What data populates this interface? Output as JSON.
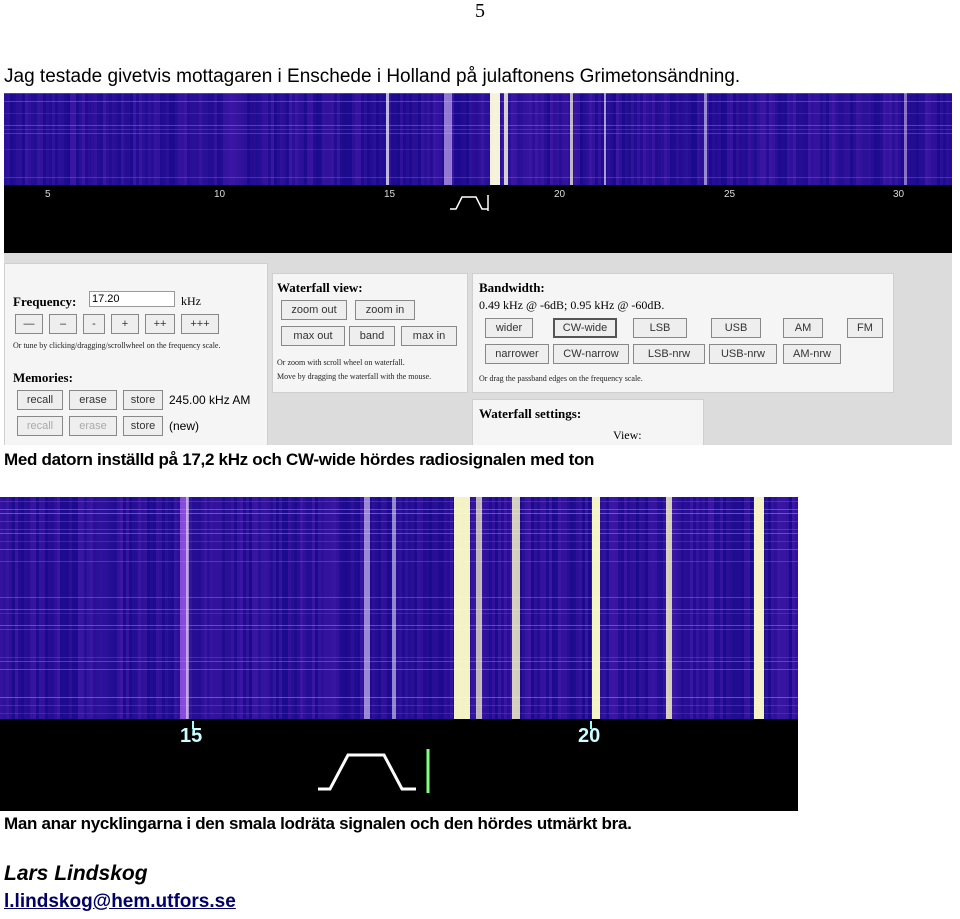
{
  "page_number": "5",
  "intro": "Jag testade givetvis mottagaren i Enschede i Holland på julaftonens Grimetonsändning.",
  "screenshot1": {
    "scale_ticks": [
      "5",
      "10",
      "15",
      "20",
      "25",
      "30"
    ],
    "frequency": {
      "label": "Frequency:",
      "value": "17.20",
      "unit": "kHz",
      "buttons": [
        "—",
        "–",
        "-",
        "+",
        "++",
        "+++"
      ],
      "hint": "Or tune by clicking/dragging/scrollwheel on the frequency scale."
    },
    "memories": {
      "label": "Memories:",
      "row1": [
        "recall",
        "erase",
        "store"
      ],
      "row1_value": "245.00 kHz AM",
      "row2": [
        "recall",
        "erase",
        "store"
      ],
      "row2_value": "(new)"
    },
    "waterfall_view": {
      "label": "Waterfall view:",
      "row1": [
        "zoom out",
        "zoom in"
      ],
      "row2": [
        "max out",
        "band",
        "max in"
      ],
      "hint1": "Or zoom with scroll wheel on waterfall.",
      "hint2": "Move by dragging the waterfall with the mouse."
    },
    "bandwidth": {
      "label": "Bandwidth:",
      "value": "0.49 kHz @ -6dB; 0.95 kHz @ -60dB.",
      "row1": [
        "wider",
        "CW-wide",
        "LSB",
        "USB",
        "AM",
        "FM"
      ],
      "row2": [
        "narrower",
        "CW-narrow",
        "LSB-nrw",
        "USB-nrw",
        "AM-nrw"
      ],
      "hint": "Or drag the passband edges on the frequency scale."
    },
    "waterfall_settings": {
      "label": "Waterfall settings:",
      "view": "View:"
    }
  },
  "caption1": "Med datorn inställd på 17,2 kHz och CW-wide hördes radiosignalen med ton",
  "screenshot2": {
    "scale_ticks": [
      "15",
      "20"
    ]
  },
  "caption2": "Man anar nycklingarna i den smala lodräta signalen och den hördes utmärkt bra.",
  "author": "Lars Lindskog",
  "email": "l.lindskog@hem.utfors.se",
  "colors": {
    "waterfall_bg": "#1a0a8c",
    "waterfall_purple": "#7a2fd0",
    "waterfall_hot": "#ffffc8",
    "scale_bg": "#000000",
    "passband": "#ffffff",
    "carrier_marker": "#7fff7f"
  }
}
